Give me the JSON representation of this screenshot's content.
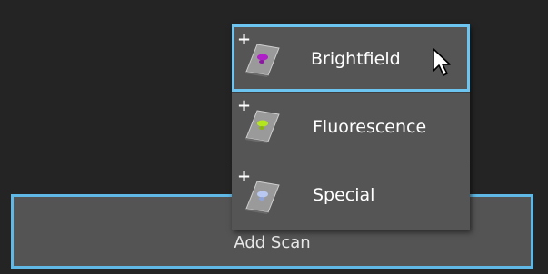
{
  "add_scan": {
    "label": "Add Scan"
  },
  "menu": {
    "items": [
      {
        "label": "Brightfield",
        "icon": "brightfield-slide-icon",
        "dot_color": "#b020c8",
        "highlighted": true
      },
      {
        "label": "Fluorescence",
        "icon": "fluorescence-slide-icon",
        "dot_color": "#b4e61e",
        "highlighted": false
      },
      {
        "label": "Special",
        "icon": "special-slide-icon",
        "dot_color": "#b8c8f0",
        "highlighted": false
      }
    ]
  },
  "colors": {
    "accent_border": "#5fb8e6",
    "menu_background": "#555555",
    "page_background": "#242424"
  }
}
